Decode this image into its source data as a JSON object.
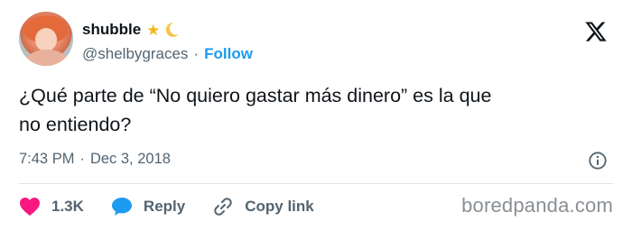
{
  "author": {
    "display_name": "shubble",
    "handle": "@shelbygraces",
    "separator": "·",
    "follow_label": "Follow",
    "emoji_icons": [
      "star-icon",
      "crescent-moon-icon"
    ]
  },
  "tweet": {
    "text": "¿Qué parte de “No quiero gastar más dinero” es la que\nno entiendo?",
    "time": "7:43 PM",
    "separator": "·",
    "date": "Dec 3, 2018"
  },
  "actions": {
    "like_count": "1.3K",
    "reply_label": "Reply",
    "copy_label": "Copy link"
  },
  "watermark": "boredpanda.com",
  "colors": {
    "text": "#0f1419",
    "secondary": "#536471",
    "accent": "#1d9bf0",
    "like": "#f91880",
    "star": "#f5b619"
  }
}
